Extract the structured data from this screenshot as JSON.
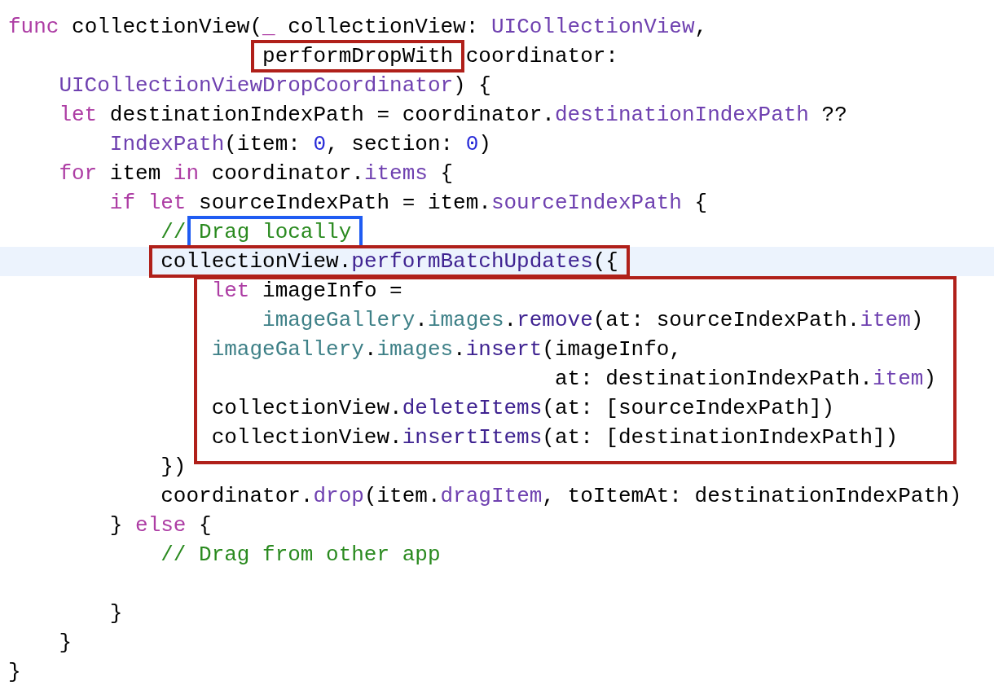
{
  "editor": {
    "lines": [
      {
        "kind": "line",
        "highlighted": false,
        "tokens": [
          {
            "kind": "keyword",
            "t": "func"
          },
          {
            "kind": "plain",
            "t": " collectionView("
          },
          {
            "kind": "keyword",
            "t": "_"
          },
          {
            "kind": "plain",
            "t": " collectionView: "
          },
          {
            "kind": "type",
            "t": "UICollectionView"
          },
          {
            "kind": "plain",
            "t": ","
          }
        ]
      },
      {
        "kind": "line",
        "highlighted": false,
        "tokens": [
          {
            "kind": "frame",
            "color": "#b0201a",
            "tokens": [
              {
                "kind": "plain",
                "t": "                    performDropWith"
              }
            ]
          },
          {
            "kind": "plain",
            "t": " coordinator:"
          }
        ]
      },
      {
        "kind": "line",
        "highlighted": false,
        "tokens": [
          {
            "kind": "type",
            "t": "    UICollectionViewDropCoordinator"
          },
          {
            "kind": "plain",
            "t": ") {"
          }
        ]
      },
      {
        "kind": "line",
        "highlighted": false,
        "tokens": [
          {
            "kind": "keyword",
            "t": "    let"
          },
          {
            "kind": "plain",
            "t": " destinationIndexPath = coordinator."
          },
          {
            "kind": "type",
            "t": "destinationIndexPath"
          },
          {
            "kind": "plain",
            "t": " ??"
          }
        ]
      },
      {
        "kind": "line",
        "highlighted": false,
        "tokens": [
          {
            "kind": "type",
            "t": "        IndexPath"
          },
          {
            "kind": "plain",
            "t": "(item: "
          },
          {
            "kind": "number",
            "t": "0"
          },
          {
            "kind": "plain",
            "t": ", section: "
          },
          {
            "kind": "number",
            "t": "0"
          },
          {
            "kind": "plain",
            "t": ")"
          }
        ]
      },
      {
        "kind": "line",
        "highlighted": false,
        "tokens": [
          {
            "kind": "keyword",
            "t": "    for"
          },
          {
            "kind": "plain",
            "t": " item "
          },
          {
            "kind": "keyword",
            "t": "in"
          },
          {
            "kind": "plain",
            "t": " coordinator."
          },
          {
            "kind": "type",
            "t": "items"
          },
          {
            "kind": "plain",
            "t": " {"
          }
        ]
      },
      {
        "kind": "line",
        "highlighted": false,
        "tokens": [
          {
            "kind": "keyword",
            "t": "        if let"
          },
          {
            "kind": "plain",
            "t": " sourceIndexPath = item."
          },
          {
            "kind": "type",
            "t": "sourceIndexPath"
          },
          {
            "kind": "plain",
            "t": " {"
          }
        ]
      },
      {
        "kind": "line",
        "highlighted": false,
        "tokens": [
          {
            "kind": "comment",
            "t": "            // "
          },
          {
            "kind": "frame",
            "color": "#1f5cf2",
            "tokens": [
              {
                "kind": "comment",
                "t": "Drag locally"
              }
            ]
          }
        ]
      },
      {
        "kind": "line",
        "highlighted": true,
        "tokens": [
          {
            "kind": "frame",
            "color": "#b0201a",
            "tokens": [
              {
                "kind": "plain",
                "t": "            collectionView."
              },
              {
                "kind": "method",
                "t": "performBatchUpdates"
              },
              {
                "kind": "plain",
                "t": "({"
              }
            ]
          }
        ]
      },
      {
        "kind": "block",
        "color": "#b0201a",
        "lines": [
          {
            "kind": "line",
            "highlighted": false,
            "tokens": [
              {
                "kind": "keyword",
                "t": "                let"
              },
              {
                "kind": "plain",
                "t": " imageInfo ="
              }
            ]
          },
          {
            "kind": "line",
            "highlighted": false,
            "tokens": [
              {
                "kind": "member",
                "t": "                    imageGallery"
              },
              {
                "kind": "plain",
                "t": "."
              },
              {
                "kind": "member",
                "t": "images"
              },
              {
                "kind": "plain",
                "t": "."
              },
              {
                "kind": "method",
                "t": "remove"
              },
              {
                "kind": "plain",
                "t": "(at: sourceIndexPath."
              },
              {
                "kind": "type",
                "t": "item"
              },
              {
                "kind": "plain",
                "t": ")"
              }
            ]
          },
          {
            "kind": "line",
            "highlighted": false,
            "tokens": [
              {
                "kind": "member",
                "t": "                imageGallery"
              },
              {
                "kind": "plain",
                "t": "."
              },
              {
                "kind": "member",
                "t": "images"
              },
              {
                "kind": "plain",
                "t": "."
              },
              {
                "kind": "method",
                "t": "insert"
              },
              {
                "kind": "plain",
                "t": "(imageInfo,"
              }
            ]
          },
          {
            "kind": "line",
            "highlighted": false,
            "tokens": [
              {
                "kind": "plain",
                "t": "                                           at: destinationIndexPath."
              },
              {
                "kind": "type",
                "t": "item"
              },
              {
                "kind": "plain",
                "t": ")"
              }
            ]
          },
          {
            "kind": "line",
            "highlighted": false,
            "tokens": [
              {
                "kind": "plain",
                "t": "                collectionView."
              },
              {
                "kind": "method",
                "t": "deleteItems"
              },
              {
                "kind": "plain",
                "t": "(at: [sourceIndexPath])"
              }
            ]
          },
          {
            "kind": "line",
            "highlighted": false,
            "tokens": [
              {
                "kind": "plain",
                "t": "                collectionView."
              },
              {
                "kind": "method",
                "t": "insertItems"
              },
              {
                "kind": "plain",
                "t": "(at: [destinationIndexPath])"
              }
            ]
          }
        ]
      },
      {
        "kind": "line",
        "highlighted": false,
        "tokens": [
          {
            "kind": "plain",
            "t": "            })"
          }
        ]
      },
      {
        "kind": "line",
        "highlighted": false,
        "tokens": [
          {
            "kind": "plain",
            "t": "            coordinator."
          },
          {
            "kind": "type",
            "t": "drop"
          },
          {
            "kind": "plain",
            "t": "(item."
          },
          {
            "kind": "type",
            "t": "dragItem"
          },
          {
            "kind": "plain",
            "t": ", toItemAt: destinationIndexPath)"
          }
        ]
      },
      {
        "kind": "line",
        "highlighted": false,
        "tokens": [
          {
            "kind": "plain",
            "t": "        } "
          },
          {
            "kind": "keyword",
            "t": "else"
          },
          {
            "kind": "plain",
            "t": " {"
          }
        ]
      },
      {
        "kind": "line",
        "highlighted": false,
        "tokens": [
          {
            "kind": "comment",
            "t": "            // Drag from other app"
          }
        ]
      },
      {
        "kind": "line",
        "highlighted": false
      },
      {
        "kind": "line",
        "highlighted": false,
        "tokens": [
          {
            "kind": "plain",
            "t": "        }"
          }
        ]
      },
      {
        "kind": "line",
        "highlighted": false,
        "tokens": [
          {
            "kind": "plain",
            "t": "    }"
          }
        ]
      },
      {
        "kind": "line",
        "highlighted": false,
        "tokens": [
          {
            "kind": "plain",
            "t": "}"
          }
        ]
      }
    ]
  }
}
